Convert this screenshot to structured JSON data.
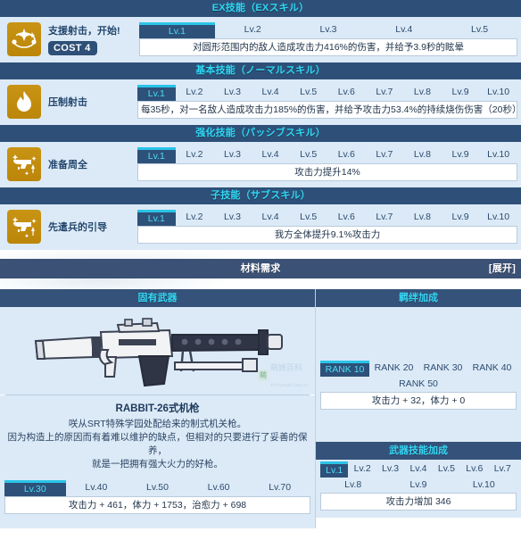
{
  "sections": [
    {
      "id": "ex",
      "header": "EX技能（EXスキル）",
      "icon": "ex-orbit-icon",
      "skill_name": "支援射击，开始!",
      "cost_label": "COST 4",
      "levels": [
        "Lv.1",
        "Lv.2",
        "Lv.3",
        "Lv.4",
        "Lv.5"
      ],
      "active_level": 0,
      "description": "对圆形范围内的敌人造成攻击力416%的伤害，并给予3.9秒的眩晕"
    },
    {
      "id": "normal",
      "header": "基本技能（ノーマルスキル）",
      "icon": "flame-icon",
      "skill_name": "压制射击",
      "cost_label": "",
      "levels": [
        "Lv.1",
        "Lv.2",
        "Lv.3",
        "Lv.4",
        "Lv.5",
        "Lv.6",
        "Lv.7",
        "Lv.8",
        "Lv.9",
        "Lv.10"
      ],
      "active_level": 0,
      "description": "每35秒，对一名敌人造成攻击力185%的伤害，并给予攻击力53.4%的持续烧伤伤害（20秒）"
    },
    {
      "id": "passive",
      "header": "强化技能（パッシブスキル）",
      "icon": "pistol-up-icon",
      "skill_name": "准备周全",
      "cost_label": "",
      "levels": [
        "Lv.1",
        "Lv.2",
        "Lv.3",
        "Lv.4",
        "Lv.5",
        "Lv.6",
        "Lv.7",
        "Lv.8",
        "Lv.9",
        "Lv.10"
      ],
      "active_level": 0,
      "description": "攻击力提升14%"
    },
    {
      "id": "sub",
      "header": "子技能（サブスキル）",
      "icon": "pistol-up-icon",
      "skill_name": "先遣兵的引导",
      "cost_label": "",
      "levels": [
        "Lv.1",
        "Lv.2",
        "Lv.3",
        "Lv.4",
        "Lv.5",
        "Lv.6",
        "Lv.7",
        "Lv.8",
        "Lv.9",
        "Lv.10"
      ],
      "active_level": 0,
      "description": "我方全体提升9.1%攻击力"
    }
  ],
  "materials": {
    "title": "材料需求",
    "expand_label": "[展开]"
  },
  "weapon": {
    "panel_title": "固有武器",
    "name": "RABBIT-26式机枪",
    "description_lines": [
      "咲从SRT特殊学园处配给来的制式机关枪。",
      "因为构造上的原因而有着难以维护的缺点，但相对的只要进行了妥善的保养，",
      "就是一把拥有强大火力的好枪。"
    ],
    "levels": [
      "Lv.30",
      "Lv.40",
      "Lv.50",
      "Lv.60",
      "Lv.70"
    ],
    "active_level": 0,
    "stats": "攻击力 + 461，体力 + 1753，治愈力 + 698",
    "watermark_badge": "萌",
    "watermark_text": "萌娘百科",
    "watermark_url": "zh.moegirl.org.cn"
  },
  "bond": {
    "panel_title": "羁绊加成",
    "ranks_row1": [
      "RANK 10",
      "RANK 20",
      "RANK 30",
      "RANK 40"
    ],
    "ranks_row2": [
      "RANK 50"
    ],
    "active_rank": 0,
    "stats": "攻击力 + 32，体力 + 0"
  },
  "weapon_skill": {
    "panel_title": "武器技能加成",
    "levels_row1": [
      "Lv.1",
      "Lv.2",
      "Lv.3",
      "Lv.4",
      "Lv.5",
      "Lv.6",
      "Lv.7"
    ],
    "levels_row2": [
      "Lv.8",
      "Lv.9",
      "Lv.10"
    ],
    "active_level": 0,
    "stats": "攻击力增加 346"
  },
  "colors": {
    "accent_cyan": "#35d6f4",
    "header_navy": "#2e5078",
    "panel_blue": "#dceaf7",
    "icon_gold": "#c2900f"
  }
}
